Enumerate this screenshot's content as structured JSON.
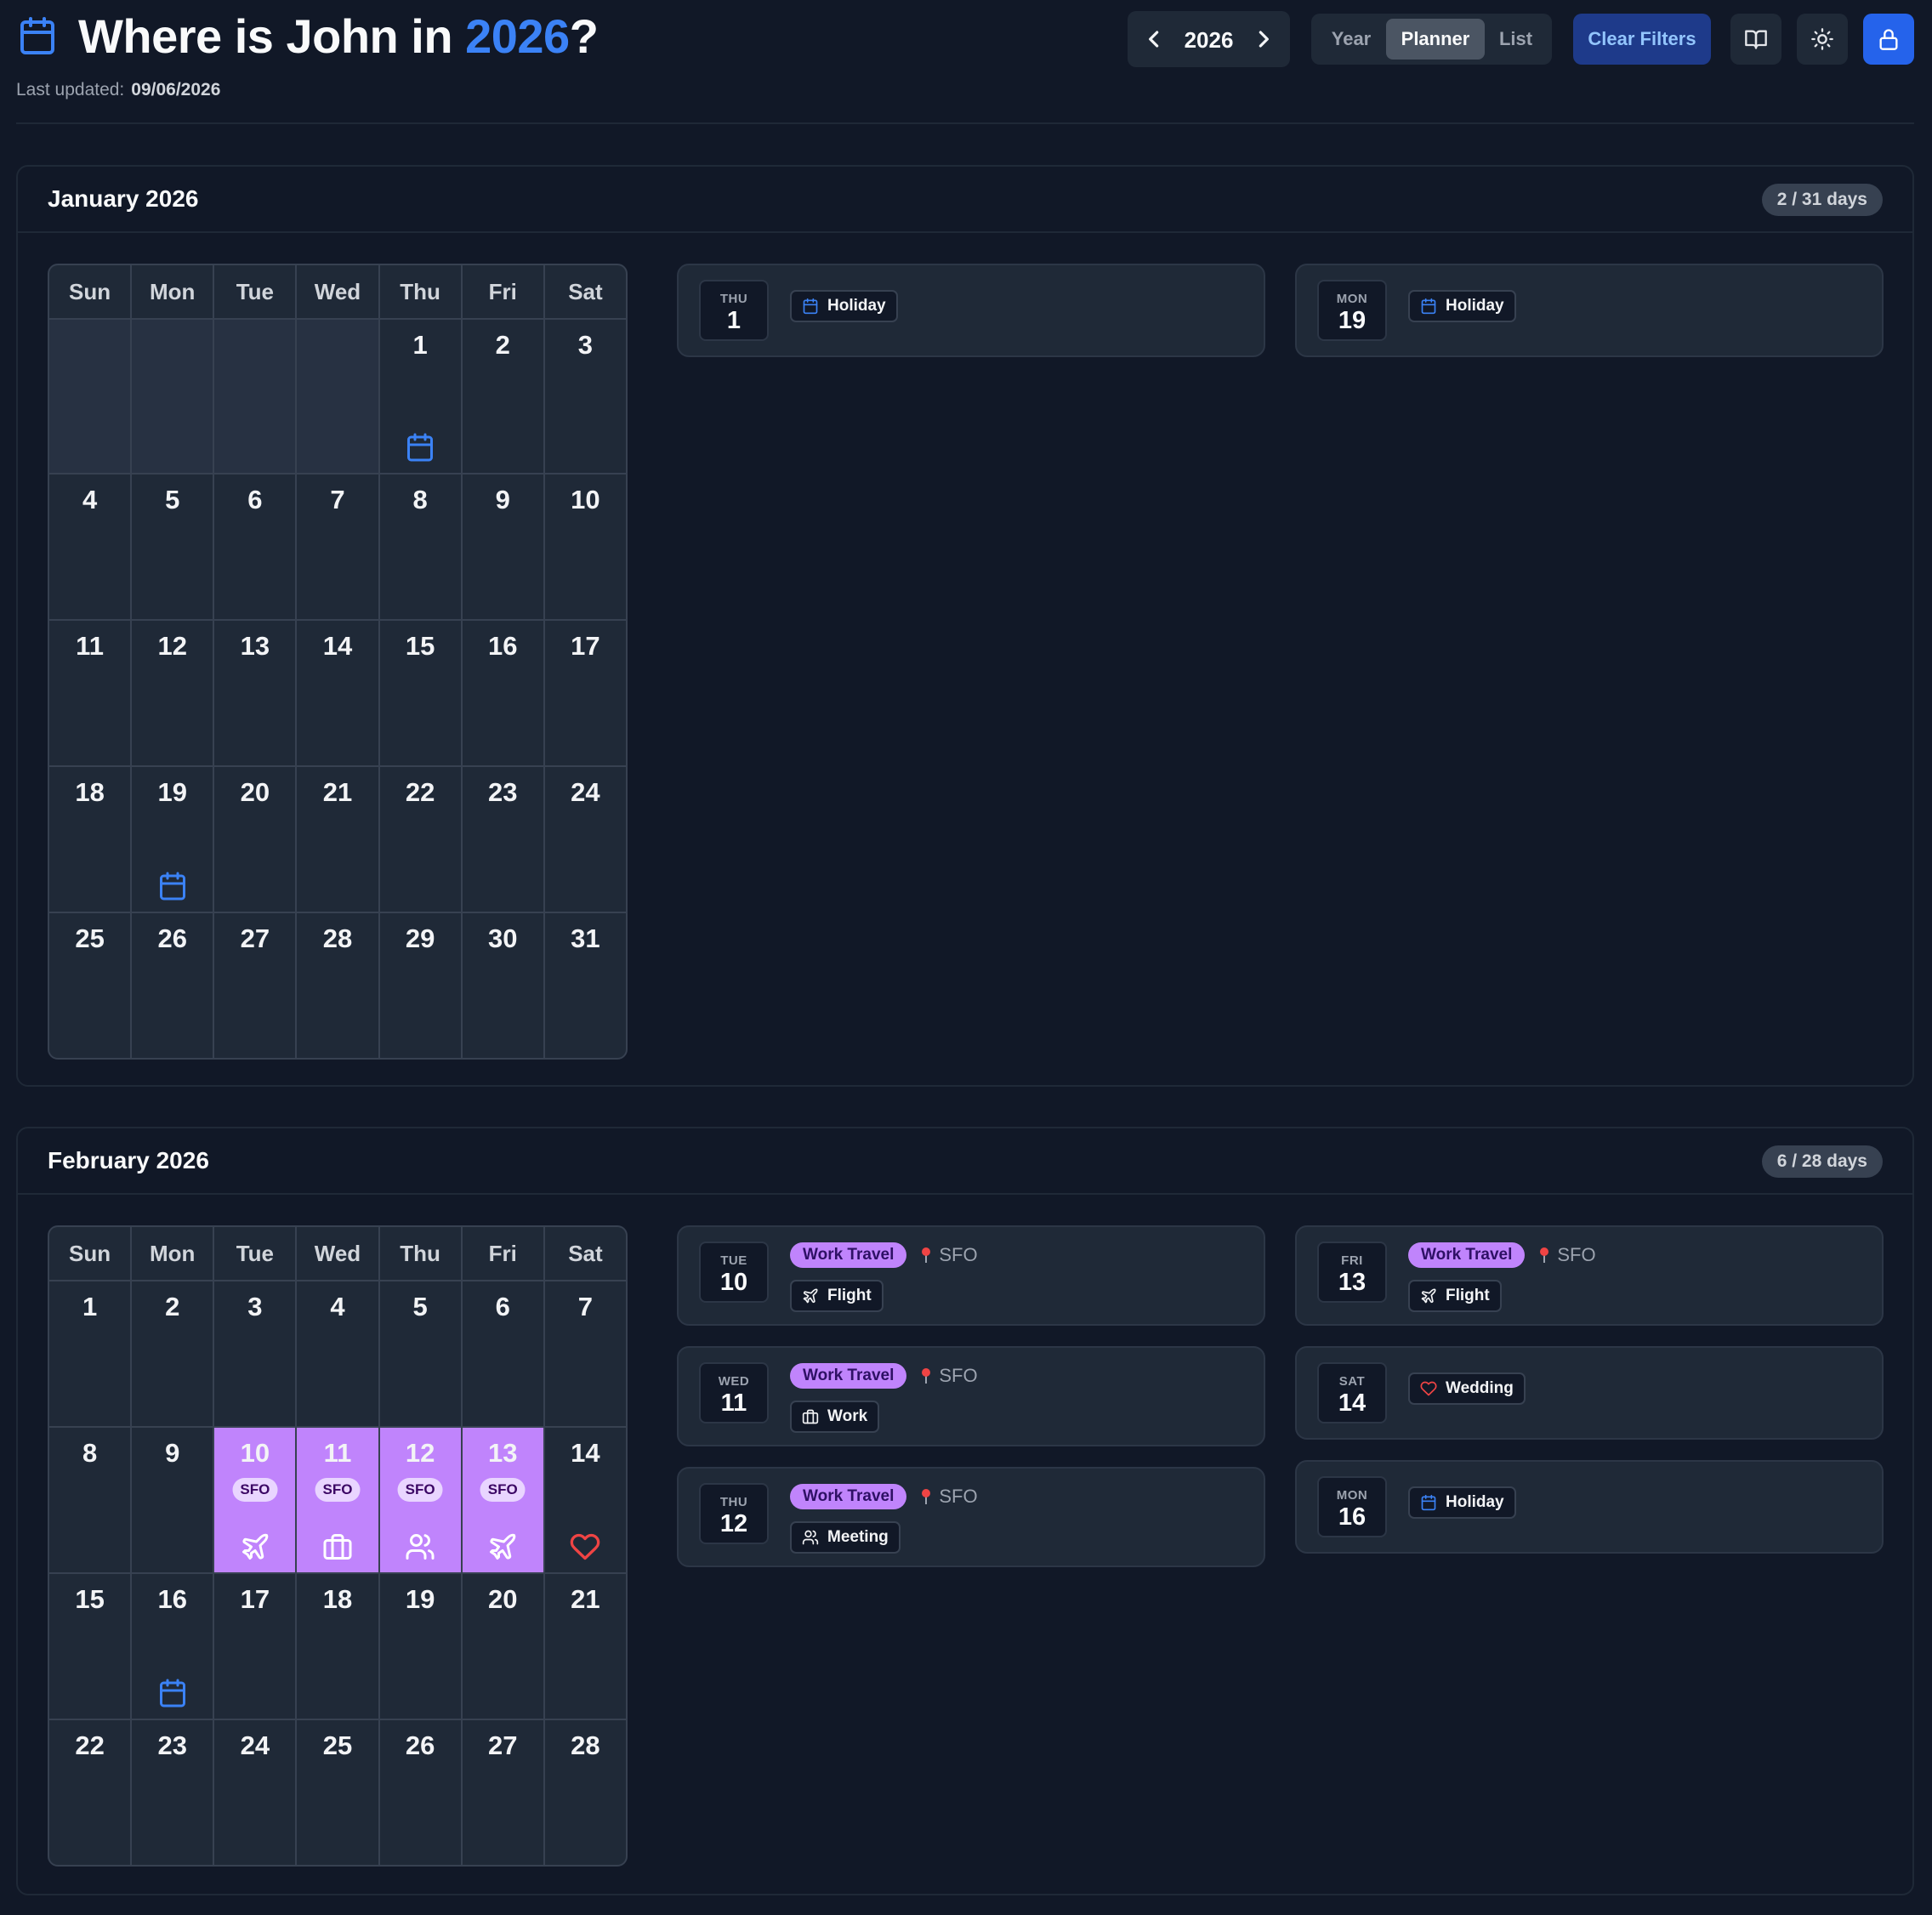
{
  "header": {
    "title_prefix": "Where is John in ",
    "title_year": "2026",
    "title_suffix": "?",
    "last_updated_label": "Last updated:",
    "last_updated_value": "09/06/2026",
    "year": "2026",
    "view_tabs": [
      "Year",
      "Planner",
      "List"
    ],
    "active_view": "Planner",
    "clear_filters": "Clear Filters",
    "icons": [
      "calendar-icon",
      "chevron-left-icon",
      "chevron-right-icon",
      "book-open-icon",
      "sun-icon",
      "lock-icon"
    ]
  },
  "colors": {
    "background": "#111827",
    "surface": "#1f2937",
    "accent": "#3b82f6",
    "work_travel": "#c084fc",
    "wedding": "#ef4444"
  },
  "weekdays": [
    "Sun",
    "Mon",
    "Tue",
    "Wed",
    "Thu",
    "Fri",
    "Sat"
  ],
  "months": [
    {
      "title": "January 2026",
      "count": "2 / 31 days",
      "lead_blanks": 4,
      "days": 31,
      "marked": [
        {
          "day": 1,
          "icon": "calendar-icon"
        },
        {
          "day": 19,
          "icon": "calendar-icon"
        }
      ],
      "events_left": [
        {
          "dow": "THU",
          "day": "1",
          "tag": "Holiday",
          "tag_icon": "calendar-icon"
        }
      ],
      "events_right": [
        {
          "dow": "MON",
          "day": "19",
          "tag": "Holiday",
          "tag_icon": "calendar-icon"
        }
      ]
    },
    {
      "title": "February 2026",
      "count": "6 / 28 days",
      "lead_blanks": 0,
      "days": 28,
      "marked": [
        {
          "day": 10,
          "travel": true,
          "loc": "SFO",
          "icon": "plane-icon"
        },
        {
          "day": 11,
          "travel": true,
          "loc": "SFO",
          "icon": "briefcase-icon"
        },
        {
          "day": 12,
          "travel": true,
          "loc": "SFO",
          "icon": "users-icon"
        },
        {
          "day": 13,
          "travel": true,
          "loc": "SFO",
          "icon": "plane-icon"
        },
        {
          "day": 14,
          "icon": "heart-icon"
        },
        {
          "day": 16,
          "icon": "calendar-icon"
        }
      ],
      "events_left": [
        {
          "dow": "TUE",
          "day": "10",
          "category": "Work Travel",
          "location": "SFO",
          "tag": "Flight",
          "tag_icon": "plane-icon"
        },
        {
          "dow": "WED",
          "day": "11",
          "category": "Work Travel",
          "location": "SFO",
          "tag": "Work",
          "tag_icon": "briefcase-icon"
        },
        {
          "dow": "THU",
          "day": "12",
          "category": "Work Travel",
          "location": "SFO",
          "tag": "Meeting",
          "tag_icon": "users-icon"
        }
      ],
      "events_right": [
        {
          "dow": "FRI",
          "day": "13",
          "category": "Work Travel",
          "location": "SFO",
          "tag": "Flight",
          "tag_icon": "plane-icon"
        },
        {
          "dow": "SAT",
          "day": "14",
          "tag": "Wedding",
          "tag_icon": "heart-icon"
        },
        {
          "dow": "MON",
          "day": "16",
          "tag": "Holiday",
          "tag_icon": "calendar-icon"
        }
      ]
    }
  ]
}
